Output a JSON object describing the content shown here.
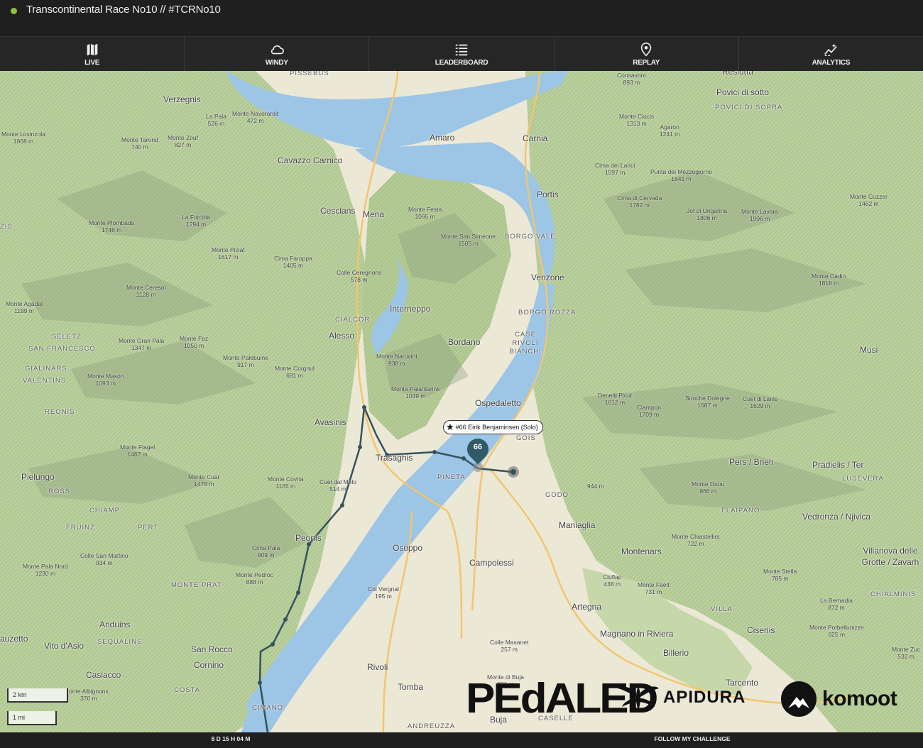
{
  "header": {
    "title": "Transcontinental Race No10 // #TCRNo10",
    "status_color": "#8bc34a"
  },
  "nav": [
    {
      "label": "LIVE",
      "icon": "map-icon"
    },
    {
      "label": "WINDY",
      "icon": "cloud-icon"
    },
    {
      "label": "LEADERBOARD",
      "icon": "list-icon"
    },
    {
      "label": "REPLAY",
      "icon": "location-pin-icon"
    },
    {
      "label": "ANALYTICS",
      "icon": "chart-sparkle-icon"
    }
  ],
  "map": {
    "rider": {
      "label": "#66 Eirik Benjaminsen (Solo)",
      "number": "66",
      "color": "#2f5a66"
    },
    "scale": {
      "metric": "2 km",
      "imperial": "1 mi"
    },
    "places": [
      "PISSEBUS",
      "Verzegnis",
      "Amaro",
      "Carnia",
      "Cavazzo Carnico",
      "Portis",
      "Cesclans",
      "Mena",
      "BORGO VALE",
      "Venzone",
      "CIALCOR",
      "Interneppo",
      "Alesso",
      "Bordano",
      "BORGO ROZZA",
      "CASE RIVOLI BIANCHI",
      "SELETZ",
      "SAN FRANCESCO",
      "GIALINARS",
      "VALENTINS",
      "REONIS",
      "Avasinis",
      "Ospedaletto",
      "GOIS",
      "Trasaghis",
      "PINETA",
      "GODO",
      "Pielungo",
      "ROSS",
      "CHIAMP",
      "FRUINZ",
      "PERT",
      "Peonis",
      "Osoppo",
      "Maniaglia",
      "Campolessi",
      "Montenars",
      "MONTE PRAT",
      "Anduins",
      "SEQUALINS",
      "Vito d'Asio",
      "San Rocco",
      "Cornino",
      "Casiacco",
      "COSTA",
      "Rivoli",
      "Tomba",
      "CIMANO",
      "ANDREUZZA",
      "Buja",
      "CASELLE",
      "Artegna",
      "Magnano in Riviera",
      "Billerio",
      "Tarcento",
      "Ciseriis",
      "VILLA",
      "Musi",
      "Pers / Brieh",
      "Pradielis / Ter",
      "LUSEVERA",
      "FLAIPANO",
      "Vedronza / Njivica",
      "Villanova delle Grotte / Zavarh",
      "CHIALMINIS",
      "Povici di sotto",
      "POVICI DI SOPRA",
      "Resiutta",
      "auzetto",
      "ZIS"
    ],
    "peaks": [
      [
        "Monte Lovinzola",
        "1868 m"
      ],
      [
        "La Pala",
        "526 m"
      ],
      [
        "Monte Navorareit",
        "472 m"
      ],
      [
        "Monte Tarond",
        "740 m"
      ],
      [
        "Monte Zouf",
        "827 m"
      ],
      [
        "Consavont",
        "893 m"
      ],
      [
        "Monte Ciucis",
        "1313 m"
      ],
      [
        "Agaron",
        "1241 m"
      ],
      [
        "Cima dei Larici",
        "1597 m"
      ],
      [
        "Punta del Mezzogiorno",
        "1841 m"
      ],
      [
        "Cima di Cervada",
        "1782 m"
      ],
      [
        "Jof di Ungarina",
        "1806 m"
      ],
      [
        "Monte Lavara",
        "1906 m"
      ],
      [
        "Monte Cuzzer",
        "1462 m"
      ],
      [
        "La Forcitta",
        "1294 m"
      ],
      [
        "Monte Plombada",
        "1746 m"
      ],
      [
        "Monte Festa",
        "1065 m"
      ],
      [
        "Monte San Simeone",
        "1505 m"
      ],
      [
        "Monte Piciat",
        "1617 m"
      ],
      [
        "Cima Faroppa",
        "1405 m"
      ],
      [
        "Colle Ceregnons",
        "578 m"
      ],
      [
        "Monte Ceresol",
        "1128 m"
      ],
      [
        "Monte Agadal",
        "1189 m"
      ],
      [
        "Monte Cadin",
        "1818 m"
      ],
      [
        "Monte Gran Pala",
        "1347 m"
      ],
      [
        "Monte Faz",
        "1050 m"
      ],
      [
        "Monte Palebuine",
        "917 m"
      ],
      [
        "Monte Corgnul",
        "681 m"
      ],
      [
        "Monte Naruvint",
        "938 m"
      ],
      [
        "Monte Palantarins",
        "1049 m"
      ],
      [
        "Monte Mason",
        "1093 m"
      ],
      [
        "Deneâl Picul",
        "1612 m"
      ],
      [
        "Ciampon",
        "1709 m"
      ],
      [
        "Siroche Dolegne",
        "1687 m"
      ],
      [
        "Cuel di Lanis",
        "1629 m"
      ],
      [
        "Monte Flagel",
        "1467 m"
      ],
      [
        "Monte Cuar",
        "1478 m"
      ],
      [
        "Monte Covria",
        "1165 m"
      ],
      [
        "Cuel dal Melo",
        "514 m"
      ],
      [
        "",
        "944 m"
      ],
      [
        "Monte Duou",
        "866 m"
      ],
      [
        "Colle San Martino",
        "934 m"
      ],
      [
        "Monte Pala Nord",
        "1230 m"
      ],
      [
        "Cima Pala",
        "909 m"
      ],
      [
        "Monte Pedroc",
        "888 m"
      ],
      [
        "Monte Chiastellirs",
        "722 m"
      ],
      [
        "Col Vergnal",
        "195 m"
      ],
      [
        "Ciuflap",
        "438 m"
      ],
      [
        "Monte Faeit",
        "731 m"
      ],
      [
        "Monte Stella",
        "785 m"
      ],
      [
        "La Bernadia",
        "872 m"
      ],
      [
        "Monte Potbellunizze",
        "825 m"
      ],
      [
        "Colle Masanet",
        "257 m"
      ],
      [
        "Monte di Buja",
        "321 m"
      ],
      [
        "Monte Zuc",
        "532 m"
      ],
      [
        "onte Albignons",
        "370 m"
      ]
    ]
  },
  "sponsors": {
    "pedaled": "PEdALED",
    "apidura": "APIDURA",
    "komoot": "komoot"
  },
  "footer": {
    "elapsed": "8 D 15 H 04 M",
    "follow": "FOLLOW MY CHALLENGE"
  }
}
